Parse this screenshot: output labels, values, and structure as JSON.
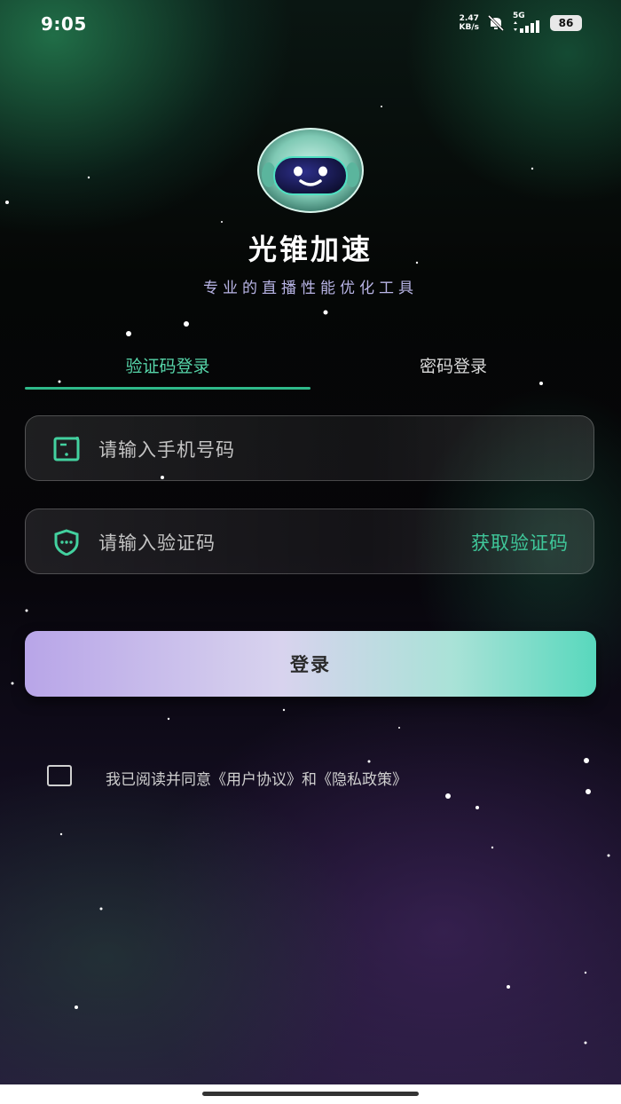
{
  "status_bar": {
    "time": "9:05",
    "net_speed_value": "2.47",
    "net_speed_unit": "KB/s",
    "network": "5G",
    "battery": "86"
  },
  "app": {
    "name": "光锥加速",
    "slogan": "专业的直播性能优化工具",
    "logo_icon": "robot-face-icon"
  },
  "tabs": [
    {
      "label": "验证码登录",
      "active": true
    },
    {
      "label": "密码登录",
      "active": false
    }
  ],
  "form": {
    "phone_placeholder": "请输入手机号码",
    "code_placeholder": "请输入验证码",
    "get_code_label": "获取验证码",
    "login_label": "登录"
  },
  "agreement": {
    "checked": false,
    "text": "我已阅读并同意《用户协议》和《隐私政策》"
  },
  "colors": {
    "accent": "#3fc79a",
    "tab_active": "#56d5a9",
    "slogan": "#b9b5e6"
  }
}
